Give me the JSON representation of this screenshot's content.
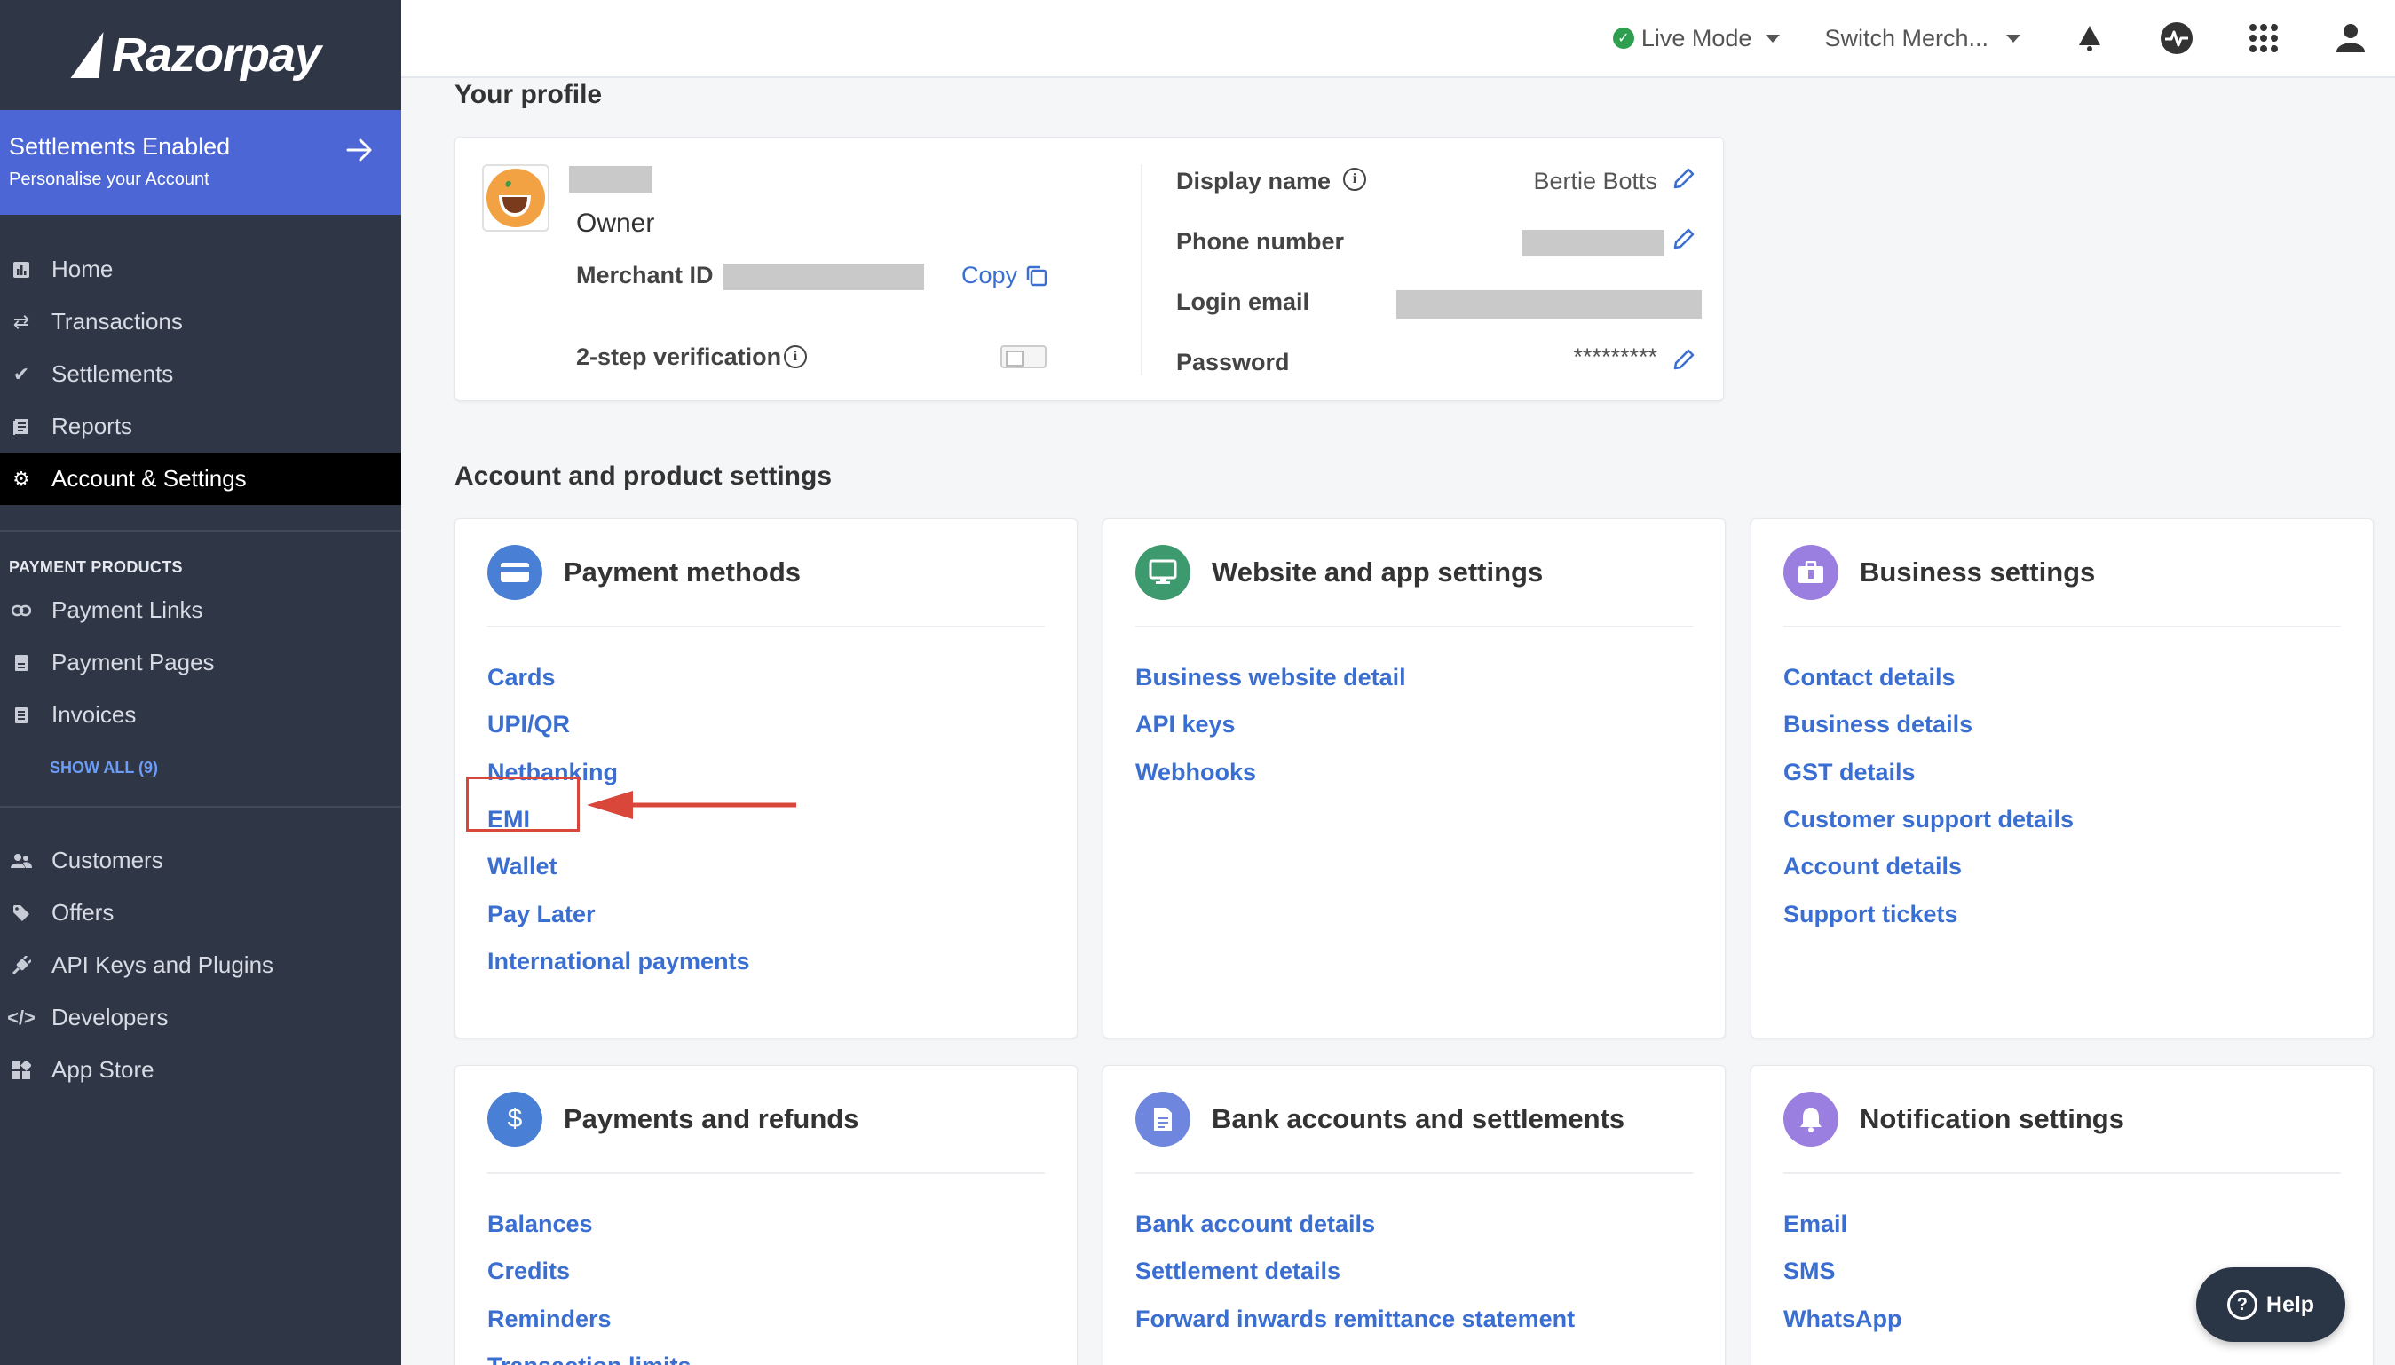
{
  "brand": {
    "name": "Razorpay"
  },
  "banner": {
    "title": "Settlements Enabled",
    "subtitle": "Personalise your Account"
  },
  "nav_main": [
    {
      "label": "Home",
      "icon": "home-icon"
    },
    {
      "label": "Transactions",
      "icon": "transactions-icon"
    },
    {
      "label": "Settlements",
      "icon": "settlements-icon"
    },
    {
      "label": "Reports",
      "icon": "reports-icon"
    },
    {
      "label": "Account & Settings",
      "icon": "gear-icon",
      "active": true
    }
  ],
  "payment_products": {
    "label": "PAYMENT PRODUCTS",
    "items": [
      {
        "label": "Payment Links",
        "icon": "link-icon"
      },
      {
        "label": "Payment Pages",
        "icon": "page-icon"
      },
      {
        "label": "Invoices",
        "icon": "invoice-icon"
      }
    ],
    "show_all": "SHOW ALL (9)"
  },
  "nav_more": [
    {
      "label": "Customers",
      "icon": "customers-icon"
    },
    {
      "label": "Offers",
      "icon": "tag-icon"
    },
    {
      "label": "API Keys and Plugins",
      "icon": "plug-icon"
    },
    {
      "label": "Developers",
      "icon": "code-icon"
    },
    {
      "label": "App Store",
      "icon": "apps-icon"
    }
  ],
  "topbar": {
    "mode": "Live Mode",
    "switch_merchant": "Switch Merch...",
    "icons": [
      "announcement-icon",
      "activity-icon",
      "grid-icon",
      "user-icon"
    ]
  },
  "profile": {
    "heading": "Your profile",
    "role": "Owner",
    "merchant_id_label": "Merchant ID",
    "copy_label": "Copy",
    "two_step_label": "2-step verification",
    "display_name_label": "Display name",
    "display_name_value": "Bertie Botts",
    "phone_label": "Phone number",
    "email_label": "Login email",
    "password_label": "Password",
    "password_value": "*********"
  },
  "settings_heading": "Account and product settings",
  "cards": [
    {
      "title": "Payment methods",
      "icon": "card-icon",
      "color": "#4a7fd6",
      "links": [
        "Cards",
        "UPI/QR",
        "Netbanking",
        "EMI",
        "Wallet",
        "Pay Later",
        "International payments"
      ]
    },
    {
      "title": "Website and app settings",
      "icon": "monitor-icon",
      "color": "#3d9a6e",
      "links": [
        "Business website detail",
        "API keys",
        "Webhooks"
      ]
    },
    {
      "title": "Business settings",
      "icon": "briefcase-icon",
      "color": "#9b7fe0",
      "links": [
        "Contact details",
        "Business details",
        "GST details",
        "Customer support details",
        "Account details",
        "Support tickets"
      ]
    },
    {
      "title": "Payments and refunds",
      "icon": "dollar-icon",
      "color": "#4a7fd6",
      "links": [
        "Balances",
        "Credits",
        "Reminders",
        "Transaction limits"
      ]
    },
    {
      "title": "Bank accounts and settlements",
      "icon": "document-icon",
      "color": "#6f86de",
      "links": [
        "Bank account details",
        "Settlement details",
        "Forward inwards remittance statement"
      ]
    },
    {
      "title": "Notification settings",
      "icon": "bell-icon",
      "color": "#9b7fe0",
      "links": [
        "Email",
        "SMS",
        "WhatsApp"
      ]
    }
  ],
  "help": {
    "label": "Help"
  },
  "colors": {
    "sidebar": "#2f3646",
    "banner": "#4c66d6",
    "link": "#3a6fd1",
    "highlight": "#d9463a"
  }
}
